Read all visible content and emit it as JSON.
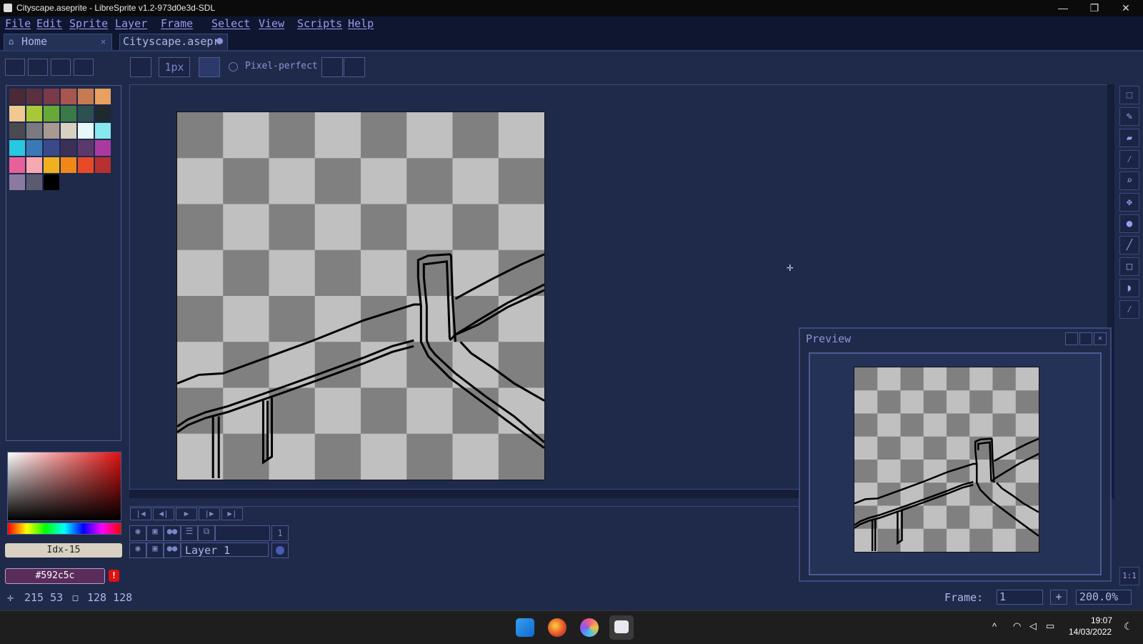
{
  "window": {
    "title": "Cityscape.aseprite - LibreSprite v1.2-973d0e3d-SDL",
    "minimize": "—",
    "maximize": "❐",
    "close": "✕"
  },
  "menu": [
    "File",
    "Edit",
    "Sprite",
    "Layer",
    "Frame",
    "Select",
    "View",
    "Scripts",
    "Help"
  ],
  "tabs": [
    {
      "label": "Home"
    },
    {
      "label": "Cityscape.asepr"
    }
  ],
  "toolbar": {
    "brush_size": "1px",
    "pixel_perfect_label": "Pixel-perfect"
  },
  "palette": {
    "colors": [
      "#4a2a36",
      "#5b3040",
      "#7a3a4a",
      "#a8564e",
      "#c67a52",
      "#e8a060",
      "#f0c890",
      "#a8c838",
      "#68a838",
      "#3a7a48",
      "#2e5050",
      "#1e2a30",
      "#4a4a50",
      "#7a7a80",
      "#a89a90",
      "#d8d0c0",
      "#e8f8f8",
      "#88e8f0",
      "#28c8e0",
      "#3a78b8",
      "#3a4a88",
      "#3a3058",
      "#5a3a6a",
      "#a83aa0",
      "#e8609a",
      "#f8a8b0",
      "#f0b020",
      "#f08818",
      "#e84a28",
      "#b83030",
      "#8a7aa0",
      "#5a5a70",
      "#000000"
    ]
  },
  "color": {
    "index_label": "Idx-15",
    "hex_label": "#592c5c",
    "warning": "!"
  },
  "timeline": {
    "frame_number": "1",
    "layer_name": "Layer 1"
  },
  "preview": {
    "title": "Preview"
  },
  "tools": [
    "select-rect",
    "pencil",
    "eraser",
    "eyedropper",
    "zoom",
    "move",
    "paint-bucket",
    "line",
    "rectangle",
    "blur",
    "spray"
  ],
  "status": {
    "cursor_pos": "215 53",
    "sprite_size": "128 128",
    "frame_label": "Frame:",
    "frame_value": "1",
    "zoom": "200.0%",
    "ratio": "1:1"
  },
  "taskbar": {
    "time": "19:07",
    "date": "14/03/2022"
  }
}
